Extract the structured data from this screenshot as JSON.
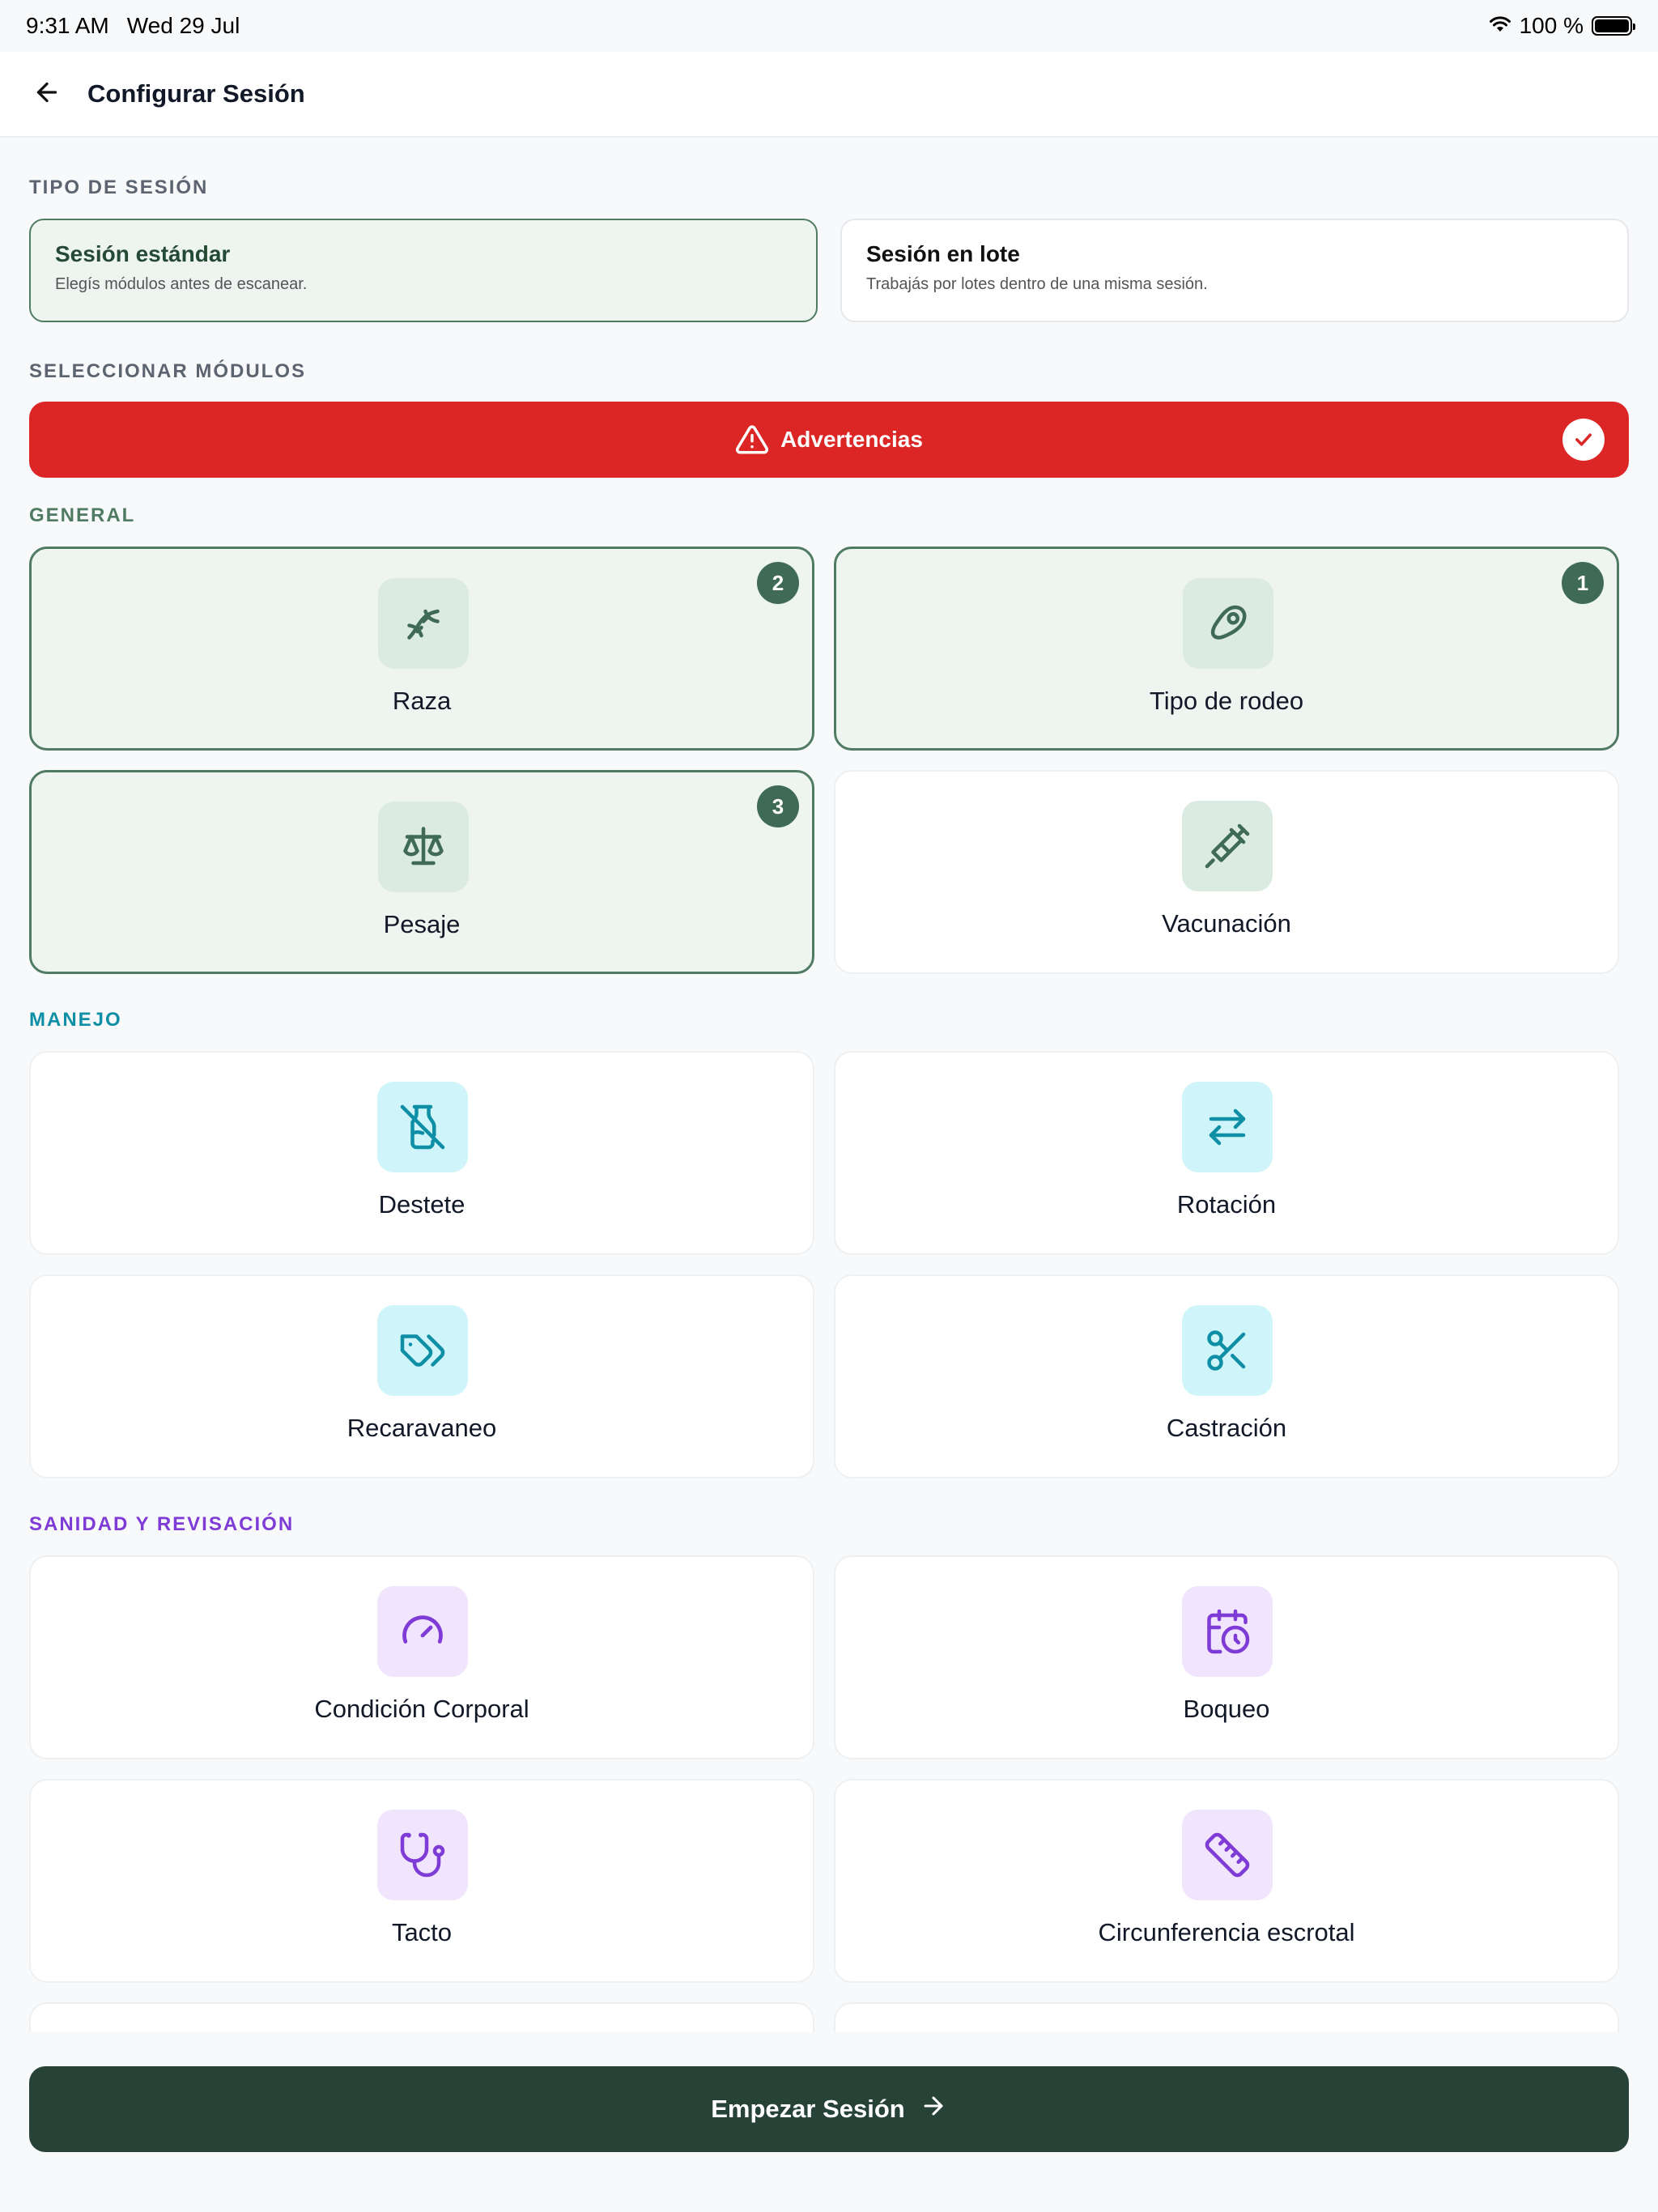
{
  "status_bar": {
    "time": "9:31 AM",
    "date": "Wed 29 Jul",
    "battery": "100 %",
    "icons": [
      "wifi-icon",
      "battery-icon"
    ]
  },
  "header": {
    "title": "Configurar Sesión",
    "back_icon": "arrow-left-icon"
  },
  "session_type": {
    "section_label": "TIPO DE SESIÓN",
    "options": [
      {
        "title": "Sesión estándar",
        "description": "Elegís módulos antes de escanear.",
        "selected": true
      },
      {
        "title": "Sesión en lote",
        "description": "Trabajás por lotes dentro de una misma sesión.",
        "selected": false
      }
    ]
  },
  "modules": {
    "section_label": "SELECCIONAR MÓDULOS",
    "warning_bar": {
      "label": "Advertencias",
      "checked": true,
      "icon": "warning-triangle-icon"
    },
    "groups": [
      {
        "label": "GENERAL",
        "color": "#4f7b62",
        "items": [
          {
            "label": "Raza",
            "icon": "dna-icon",
            "selected": true,
            "badge": "2"
          },
          {
            "label": "Tipo de rodeo",
            "icon": "meat-icon",
            "selected": true,
            "badge": "1"
          },
          {
            "label": "Pesaje",
            "icon": "scale-icon",
            "selected": true,
            "badge": "3"
          },
          {
            "label": "Vacunación",
            "icon": "syringe-icon",
            "selected": false,
            "badge": ""
          }
        ]
      },
      {
        "label": "MANEJO",
        "color": "#0e8fa5",
        "items": [
          {
            "label": "Destete",
            "icon": "milk-off-icon",
            "selected": false
          },
          {
            "label": "Rotación",
            "icon": "arrows-swap-icon",
            "selected": false
          },
          {
            "label": "Recaravaneo",
            "icon": "tags-icon",
            "selected": false
          },
          {
            "label": "Castración",
            "icon": "scissors-icon",
            "selected": false
          }
        ]
      },
      {
        "label": "SANIDAD Y REVISACIÓN",
        "color": "#7e3bd6",
        "items": [
          {
            "label": "Condición Corporal",
            "icon": "gauge-icon",
            "selected": false
          },
          {
            "label": "Boqueo",
            "icon": "calendar-clock-icon",
            "selected": false
          },
          {
            "label": "Tacto",
            "icon": "stethoscope-icon",
            "selected": false
          },
          {
            "label": "Circunferencia escrotal",
            "icon": "ruler-icon",
            "selected": false
          }
        ]
      }
    ]
  },
  "start_button": {
    "label": "Empezar Sesión",
    "icon": "arrow-right-icon"
  },
  "colors": {
    "primary_dark": "#274337",
    "selected_border": "#4f7b62",
    "selected_bg": "#eef4f0",
    "warning_red": "#dc2626",
    "manejo_accent": "#0e8fa5",
    "sanidad_accent": "#7e3bd6"
  }
}
